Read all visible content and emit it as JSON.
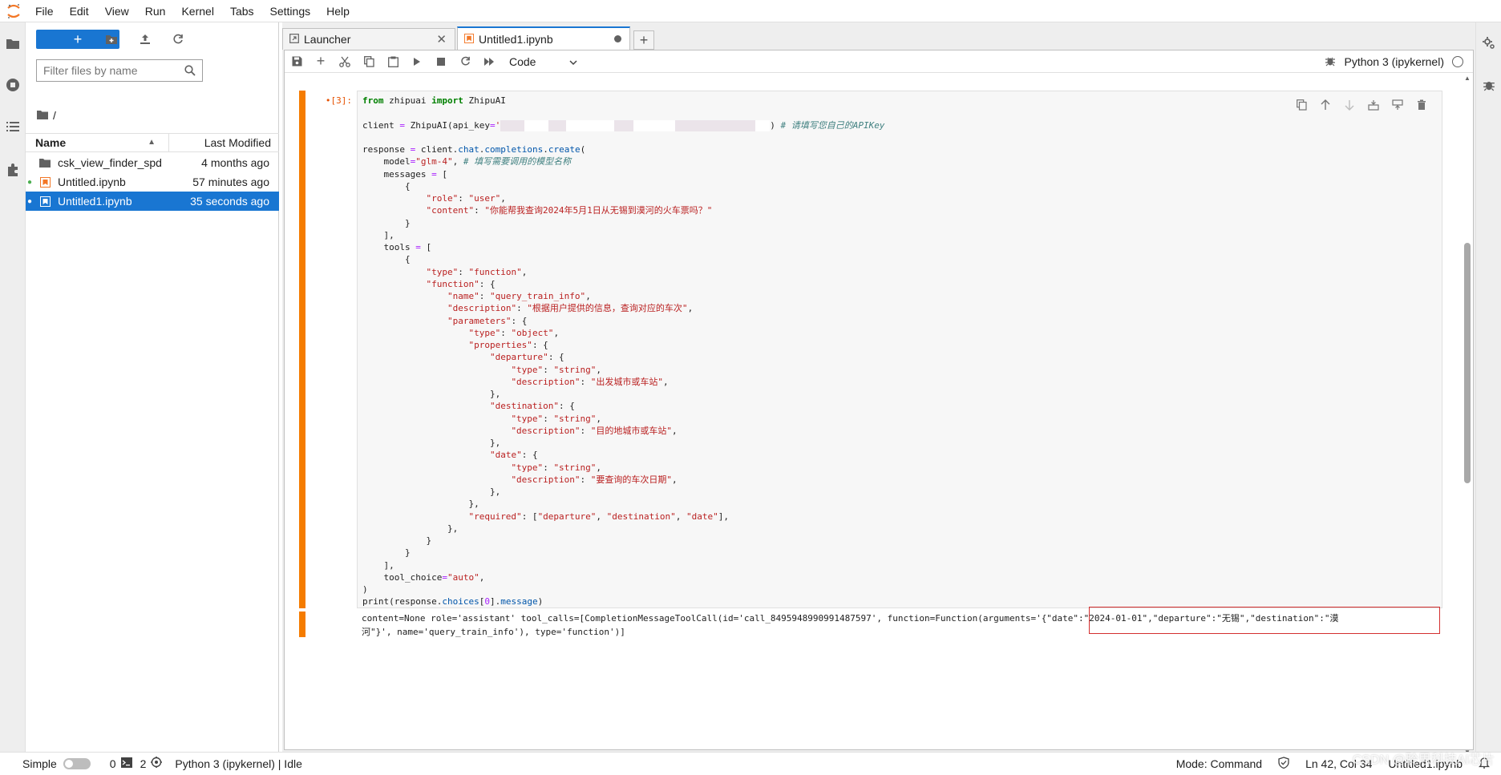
{
  "menu": [
    "File",
    "Edit",
    "View",
    "Run",
    "Kernel",
    "Tabs",
    "Settings",
    "Help"
  ],
  "filebrowser": {
    "new_label": "+",
    "filter_placeholder": "Filter files by name",
    "crumb": "/",
    "header_name": "Name",
    "header_modified": "Last Modified",
    "files": [
      {
        "name": "csk_view_finder_spd",
        "modified": "4 months ago",
        "type": "folder",
        "running": false
      },
      {
        "name": "Untitled.ipynb",
        "modified": "57 minutes ago",
        "type": "notebook",
        "running": true
      },
      {
        "name": "Untitled1.ipynb",
        "modified": "35 seconds ago",
        "type": "notebook",
        "running": true
      }
    ]
  },
  "tabs": [
    {
      "label": "Launcher",
      "icon": "launcher-icon"
    },
    {
      "label": "Untitled1.ipynb",
      "icon": "notebook-icon"
    }
  ],
  "toolbar": {
    "cell_type": "Code",
    "kernel_name": "Python 3 (ipykernel)"
  },
  "cell": {
    "prompt": "[3]:",
    "output_line1": "content=None role='assistant' tool_calls=[CompletionMessageToolCall(id='call_8495948990991487597', function=Function(arguments='{\"date\":\"2024-01-01\",\"departure\":\"无锡\",\"destination\":\"漠",
    "output_line2": "河\"}', name='query_train_info'), type='function')]"
  },
  "statusbar": {
    "mode_label": "Simple",
    "terminals": "0",
    "kernels": "2",
    "kernel_status": "Python 3 (ipykernel) | Idle",
    "mode": "Mode: Command",
    "position": "Ln 42, Col 34",
    "file": "Untitled1.ipynb"
  },
  "watermark": "CSDN @聆思科技AI芯片",
  "colors": {
    "accent": "#1976d2",
    "cell_bar": "#f57c00",
    "highlight_box": "#d32f2f"
  }
}
